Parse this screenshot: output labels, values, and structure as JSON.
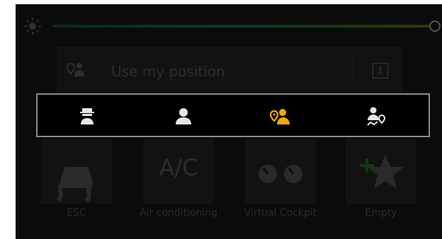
{
  "colors": {
    "accent": "#f2a900",
    "icon": "#e6e6e6",
    "dim": "#2e2e2e"
  },
  "brightness": {
    "icon": "sun-icon",
    "level": 1.0
  },
  "position_bar": {
    "label": "Use my position",
    "icon": "location-person-icon",
    "info_icon": "info-icon",
    "info_glyph": "i"
  },
  "popup_options": [
    {
      "icon": "incognito-person-icon",
      "selected": false
    },
    {
      "icon": "person-icon",
      "selected": false
    },
    {
      "icon": "location-person-icon",
      "selected": true
    },
    {
      "icon": "person-route-location-icon",
      "selected": false
    }
  ],
  "tiles": [
    {
      "label": "ESC",
      "icon": "esc-skid-icon"
    },
    {
      "label": "Air conditioning",
      "icon": "ac-icon",
      "icon_text": "A/C"
    },
    {
      "label": "Virtual Cockpit",
      "icon": "gauges-icon"
    },
    {
      "label": "Empty",
      "icon": "add-favorite-star-icon"
    }
  ]
}
